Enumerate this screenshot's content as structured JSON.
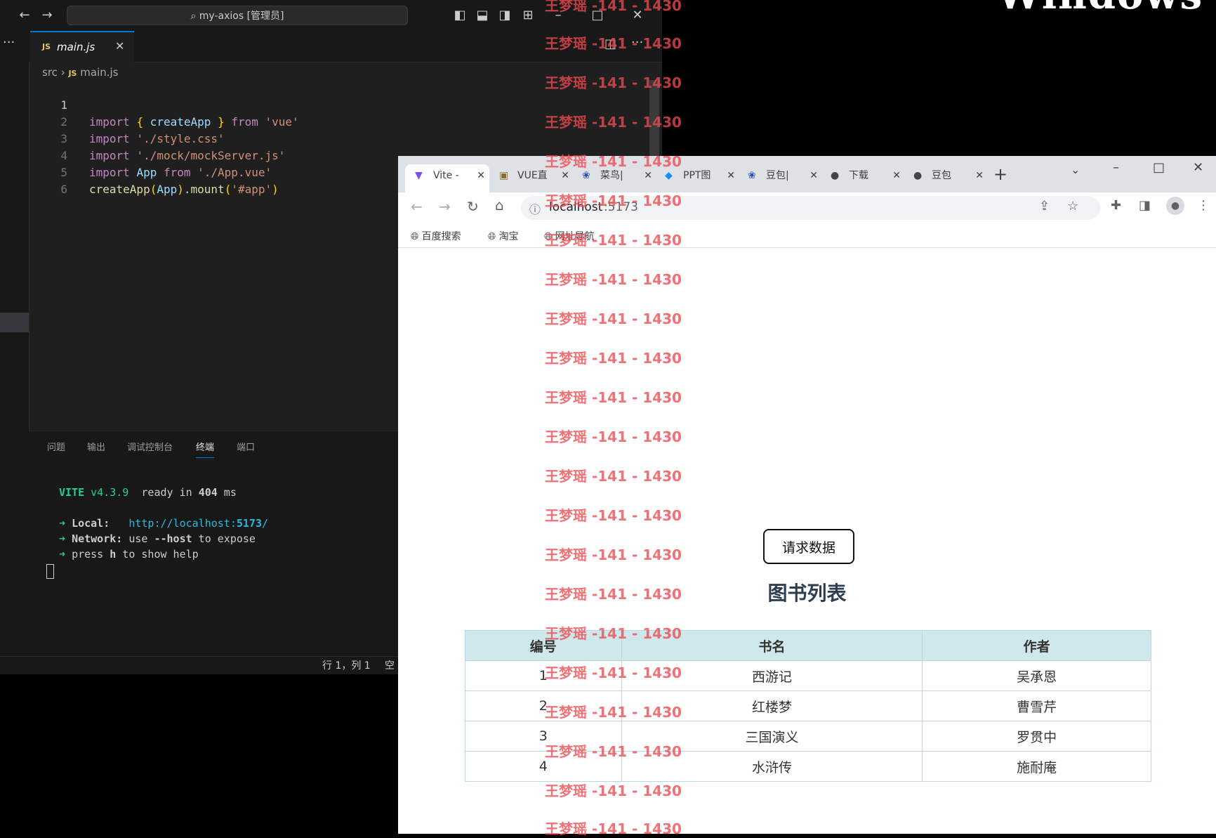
{
  "vscode": {
    "command_center": "my-axios [管理员]",
    "tab": {
      "badge": "JS",
      "label": "main.js"
    },
    "breadcrumb": {
      "folder": "src",
      "badge": "JS",
      "file": "main.js"
    },
    "code_lines": [
      {
        "n": "1"
      },
      {
        "n": "2"
      },
      {
        "n": "3"
      },
      {
        "n": "4"
      },
      {
        "n": "5"
      },
      {
        "n": "6"
      }
    ],
    "code_tokens": {
      "l1": [
        "import",
        " ",
        "{",
        " ",
        "createApp",
        " ",
        "}",
        " from ",
        "'vue'"
      ],
      "l2": [
        "import",
        " ",
        "'./style.css'"
      ],
      "l3": [
        "import",
        " ",
        "'./mock/mockServer.js'"
      ],
      "l4": [
        "import",
        " ",
        "App",
        " from ",
        "'./App.vue'"
      ],
      "l5": [
        "createApp",
        "(",
        "App",
        ")",
        ".",
        "mount",
        "(",
        "'#app'",
        ")"
      ]
    },
    "panel_tabs": [
      "问题",
      "输出",
      "调试控制台",
      "终端",
      "端口"
    ],
    "terminal": {
      "vite": "VITE",
      "version": " v4.3.9",
      "ready": "  ready in ",
      "ms": "404",
      "ms_unit": " ms",
      "arrow": "➜",
      "local_label": "Local:",
      "local_url_a": "http://localhost:",
      "local_url_port": "5173",
      "local_url_b": "/",
      "network_label": "Network:",
      "network_text_a": " use ",
      "network_flag": "--host",
      "network_text_b": " to expose",
      "help_a": "press ",
      "help_key": "h",
      "help_b": " to show help"
    },
    "status": {
      "position": "行 1，列 1",
      "spaces": "空"
    }
  },
  "chrome": {
    "tabs": [
      {
        "label": "Vite -",
        "active": true
      },
      {
        "label": "VUE直"
      },
      {
        "label": "菜鸟|"
      },
      {
        "label": "PPT图"
      },
      {
        "label": "豆包|"
      },
      {
        "label": "下载"
      },
      {
        "label": "豆包"
      }
    ],
    "new_tab": "+",
    "url_host": "localhost",
    "url_port": ":5173",
    "bookmarks": [
      "百度搜索",
      "淘宝",
      "网址导航"
    ],
    "page": {
      "button": "请求数据",
      "title": "图书列表",
      "columns": [
        "编号",
        "书名",
        "作者"
      ],
      "rows": [
        [
          "1",
          "西游记",
          "吴承恩"
        ],
        [
          "2",
          "红楼梦",
          "曹雪芹"
        ],
        [
          "3",
          "三国演义",
          "罗贯中"
        ],
        [
          "4",
          "水浒传",
          "施耐庵"
        ]
      ]
    }
  },
  "desktop": {
    "corner_text": "Windows"
  },
  "watermark": "王梦瑶 -141 - 1430"
}
